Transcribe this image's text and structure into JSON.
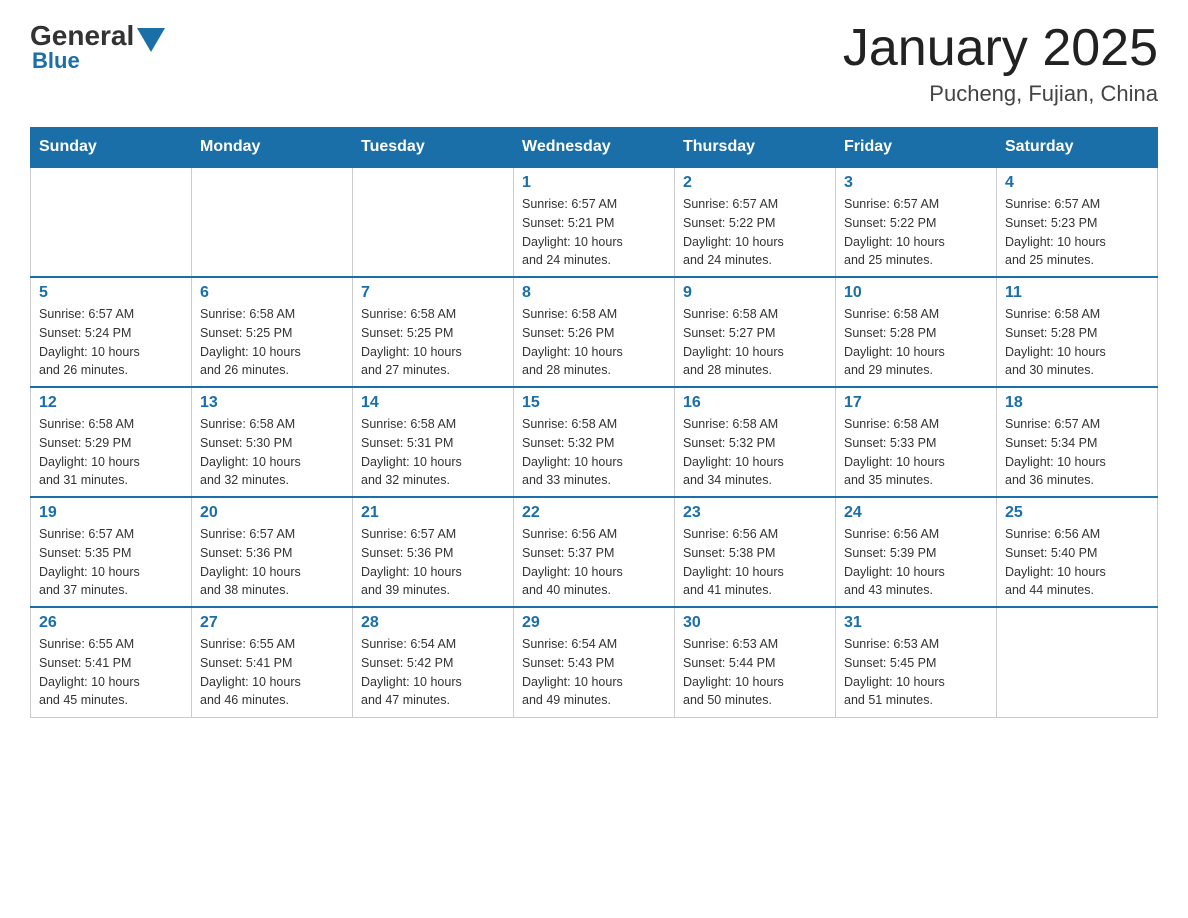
{
  "header": {
    "logo_general": "General",
    "logo_blue": "Blue",
    "logo_arrow": "▲",
    "title": "January 2025",
    "subtitle": "Pucheng, Fujian, China"
  },
  "days_of_week": [
    "Sunday",
    "Monday",
    "Tuesday",
    "Wednesday",
    "Thursday",
    "Friday",
    "Saturday"
  ],
  "weeks": [
    {
      "days": [
        {
          "number": "",
          "info": ""
        },
        {
          "number": "",
          "info": ""
        },
        {
          "number": "",
          "info": ""
        },
        {
          "number": "1",
          "info": "Sunrise: 6:57 AM\nSunset: 5:21 PM\nDaylight: 10 hours\nand 24 minutes."
        },
        {
          "number": "2",
          "info": "Sunrise: 6:57 AM\nSunset: 5:22 PM\nDaylight: 10 hours\nand 24 minutes."
        },
        {
          "number": "3",
          "info": "Sunrise: 6:57 AM\nSunset: 5:22 PM\nDaylight: 10 hours\nand 25 minutes."
        },
        {
          "number": "4",
          "info": "Sunrise: 6:57 AM\nSunset: 5:23 PM\nDaylight: 10 hours\nand 25 minutes."
        }
      ]
    },
    {
      "days": [
        {
          "number": "5",
          "info": "Sunrise: 6:57 AM\nSunset: 5:24 PM\nDaylight: 10 hours\nand 26 minutes."
        },
        {
          "number": "6",
          "info": "Sunrise: 6:58 AM\nSunset: 5:25 PM\nDaylight: 10 hours\nand 26 minutes."
        },
        {
          "number": "7",
          "info": "Sunrise: 6:58 AM\nSunset: 5:25 PM\nDaylight: 10 hours\nand 27 minutes."
        },
        {
          "number": "8",
          "info": "Sunrise: 6:58 AM\nSunset: 5:26 PM\nDaylight: 10 hours\nand 28 minutes."
        },
        {
          "number": "9",
          "info": "Sunrise: 6:58 AM\nSunset: 5:27 PM\nDaylight: 10 hours\nand 28 minutes."
        },
        {
          "number": "10",
          "info": "Sunrise: 6:58 AM\nSunset: 5:28 PM\nDaylight: 10 hours\nand 29 minutes."
        },
        {
          "number": "11",
          "info": "Sunrise: 6:58 AM\nSunset: 5:28 PM\nDaylight: 10 hours\nand 30 minutes."
        }
      ]
    },
    {
      "days": [
        {
          "number": "12",
          "info": "Sunrise: 6:58 AM\nSunset: 5:29 PM\nDaylight: 10 hours\nand 31 minutes."
        },
        {
          "number": "13",
          "info": "Sunrise: 6:58 AM\nSunset: 5:30 PM\nDaylight: 10 hours\nand 32 minutes."
        },
        {
          "number": "14",
          "info": "Sunrise: 6:58 AM\nSunset: 5:31 PM\nDaylight: 10 hours\nand 32 minutes."
        },
        {
          "number": "15",
          "info": "Sunrise: 6:58 AM\nSunset: 5:32 PM\nDaylight: 10 hours\nand 33 minutes."
        },
        {
          "number": "16",
          "info": "Sunrise: 6:58 AM\nSunset: 5:32 PM\nDaylight: 10 hours\nand 34 minutes."
        },
        {
          "number": "17",
          "info": "Sunrise: 6:58 AM\nSunset: 5:33 PM\nDaylight: 10 hours\nand 35 minutes."
        },
        {
          "number": "18",
          "info": "Sunrise: 6:57 AM\nSunset: 5:34 PM\nDaylight: 10 hours\nand 36 minutes."
        }
      ]
    },
    {
      "days": [
        {
          "number": "19",
          "info": "Sunrise: 6:57 AM\nSunset: 5:35 PM\nDaylight: 10 hours\nand 37 minutes."
        },
        {
          "number": "20",
          "info": "Sunrise: 6:57 AM\nSunset: 5:36 PM\nDaylight: 10 hours\nand 38 minutes."
        },
        {
          "number": "21",
          "info": "Sunrise: 6:57 AM\nSunset: 5:36 PM\nDaylight: 10 hours\nand 39 minutes."
        },
        {
          "number": "22",
          "info": "Sunrise: 6:56 AM\nSunset: 5:37 PM\nDaylight: 10 hours\nand 40 minutes."
        },
        {
          "number": "23",
          "info": "Sunrise: 6:56 AM\nSunset: 5:38 PM\nDaylight: 10 hours\nand 41 minutes."
        },
        {
          "number": "24",
          "info": "Sunrise: 6:56 AM\nSunset: 5:39 PM\nDaylight: 10 hours\nand 43 minutes."
        },
        {
          "number": "25",
          "info": "Sunrise: 6:56 AM\nSunset: 5:40 PM\nDaylight: 10 hours\nand 44 minutes."
        }
      ]
    },
    {
      "days": [
        {
          "number": "26",
          "info": "Sunrise: 6:55 AM\nSunset: 5:41 PM\nDaylight: 10 hours\nand 45 minutes."
        },
        {
          "number": "27",
          "info": "Sunrise: 6:55 AM\nSunset: 5:41 PM\nDaylight: 10 hours\nand 46 minutes."
        },
        {
          "number": "28",
          "info": "Sunrise: 6:54 AM\nSunset: 5:42 PM\nDaylight: 10 hours\nand 47 minutes."
        },
        {
          "number": "29",
          "info": "Sunrise: 6:54 AM\nSunset: 5:43 PM\nDaylight: 10 hours\nand 49 minutes."
        },
        {
          "number": "30",
          "info": "Sunrise: 6:53 AM\nSunset: 5:44 PM\nDaylight: 10 hours\nand 50 minutes."
        },
        {
          "number": "31",
          "info": "Sunrise: 6:53 AM\nSunset: 5:45 PM\nDaylight: 10 hours\nand 51 minutes."
        },
        {
          "number": "",
          "info": ""
        }
      ]
    }
  ]
}
